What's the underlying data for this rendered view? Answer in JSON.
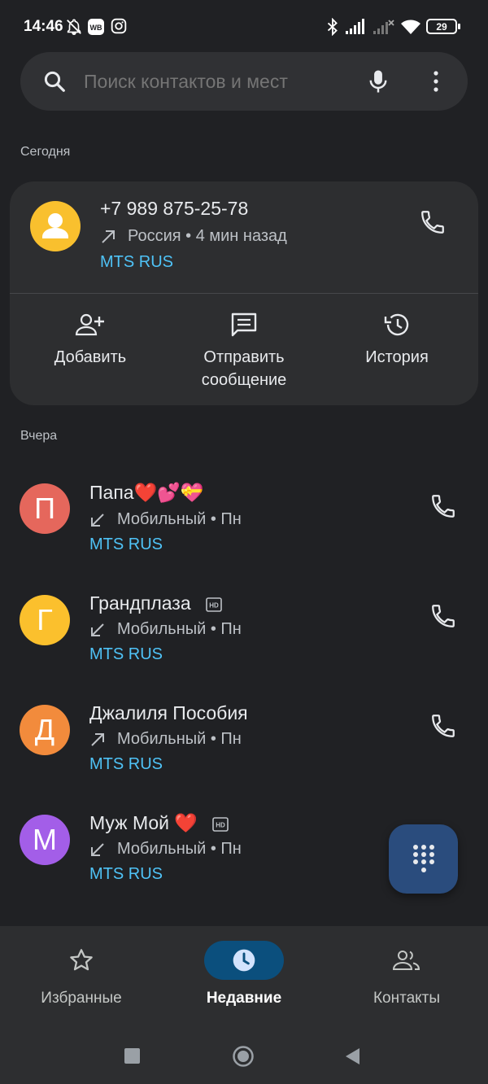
{
  "status_bar": {
    "time": "14:46",
    "battery": "29",
    "icons": [
      "bell-off-icon",
      "wb-app-icon",
      "instagram-icon",
      "bluetooth-icon",
      "signal-icon",
      "signal-no-service-icon",
      "wifi-icon",
      "battery-icon"
    ]
  },
  "search": {
    "placeholder": "Поиск контактов и мест"
  },
  "sections": {
    "today": "Сегодня",
    "yesterday": "Вчера"
  },
  "expanded_call": {
    "number": "+7 989 875-25-78",
    "meta": "Россия • 4 мин назад",
    "direction": "outgoing",
    "carrier": "MTS RUS",
    "actions": {
      "add": "Добавить",
      "message_line1": "Отправить",
      "message_line2": "сообщение",
      "history": "История"
    }
  },
  "calls": [
    {
      "initial": "П",
      "name": "Папа❤️💕💝",
      "meta": "Мобильный • Пн",
      "direction": "incoming",
      "carrier": "MTS RUS",
      "avatar_color": "#e5675c",
      "hd": false
    },
    {
      "initial": "Г",
      "name": "Грандплаза",
      "meta": "Мобильный • Пн",
      "direction": "incoming",
      "carrier": "MTS RUS",
      "avatar_color": "#fbc02d",
      "hd": true
    },
    {
      "initial": "Д",
      "name": "Джалиля Пособия",
      "meta": "Мобильный • Пн",
      "direction": "outgoing",
      "carrier": "MTS RUS",
      "avatar_color": "#f28b3c",
      "hd": false
    },
    {
      "initial": "М",
      "name": "Муж Мой ❤️",
      "meta": "Мобильный • Пн",
      "direction": "incoming",
      "carrier": "MTS RUS",
      "avatar_color": "#a35ee8",
      "hd": true
    }
  ],
  "bottom_nav": {
    "favorites": "Избранные",
    "recent": "Недавние",
    "contacts": "Контакты",
    "active": "recent"
  },
  "colors": {
    "background": "#202124",
    "card": "#2d2e30",
    "carrier_text": "#4fc3f7",
    "fab": "#2a4c7d",
    "active_tab": "#0b4f7d"
  }
}
